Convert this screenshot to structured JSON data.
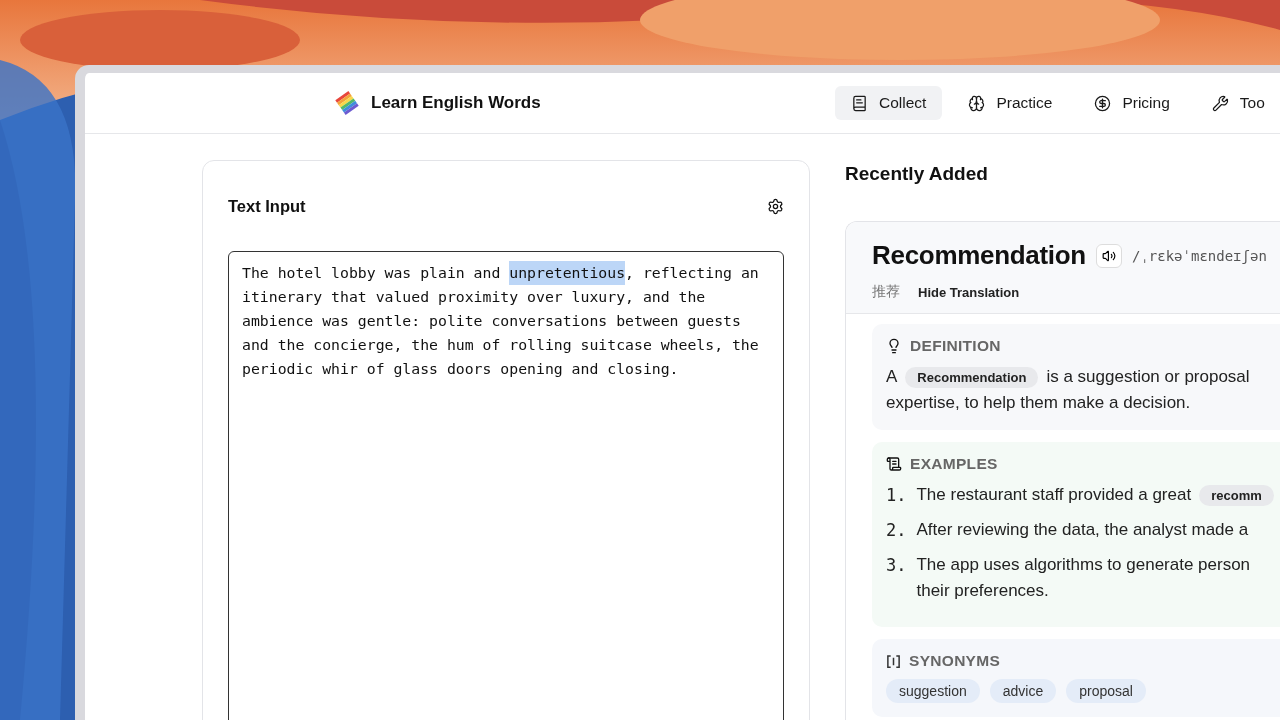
{
  "app": {
    "title": "Learn English Words"
  },
  "nav": [
    {
      "label": "Collect",
      "selected": true
    },
    {
      "label": "Practice",
      "selected": false
    },
    {
      "label": "Pricing",
      "selected": false
    },
    {
      "label": "Too",
      "selected": false
    }
  ],
  "text_input": {
    "title": "Text Input",
    "lines": [
      [
        {
          "text": "The hotel lobby was plain and ",
          "selected": false
        },
        {
          "text": "unpretentious",
          "selected": true
        },
        {
          "text": ", reflecting an",
          "selected": false
        }
      ],
      [
        {
          "text": "itinerary that valued proximity over luxury, and the",
          "selected": false
        }
      ],
      [
        {
          "text": "ambience was gentle: polite conversations between guests",
          "selected": false
        }
      ],
      [
        {
          "text": "and the concierge, the hum of rolling suitcase wheels, the",
          "selected": false
        }
      ],
      [
        {
          "text": "periodic whir of glass doors opening and closing.",
          "selected": false
        }
      ]
    ]
  },
  "recent": {
    "title": "Recently Added",
    "word": "Recommendation",
    "phonetic": "/ˌrɛkəˈmɛndeɪʃən",
    "translation": "推荐",
    "toggle": "Hide Translation",
    "definition": {
      "heading": "DEFINITION",
      "lines": [
        [
          {
            "text": "A",
            "kind": "plain"
          },
          {
            "text": "Recommendation",
            "kind": "term"
          },
          {
            "text": "is a suggestion or proposal",
            "kind": "plain"
          }
        ],
        [
          {
            "text": "expertise, to help them make a decision.",
            "kind": "plain"
          }
        ]
      ]
    },
    "examples": {
      "heading": "EXAMPLES",
      "items": [
        {
          "number": "1.",
          "lines": [
            [
              {
                "text": "The restaurant staff provided a great",
                "kind": "plain"
              },
              {
                "text": "recomm",
                "kind": "term"
              }
            ]
          ]
        },
        {
          "number": "2.",
          "lines": [
            [
              {
                "text": "After reviewing the data, the analyst made a",
                "kind": "plain"
              }
            ]
          ]
        },
        {
          "number": "3.",
          "lines": [
            [
              {
                "text": "The app uses algorithms to generate person",
                "kind": "plain"
              }
            ],
            [
              {
                "text": "their preferences.",
                "kind": "plain"
              }
            ]
          ]
        }
      ]
    },
    "synonyms": {
      "heading": "SYNONYMS",
      "items": [
        "suggestion",
        "advice",
        "proposal"
      ]
    }
  }
}
